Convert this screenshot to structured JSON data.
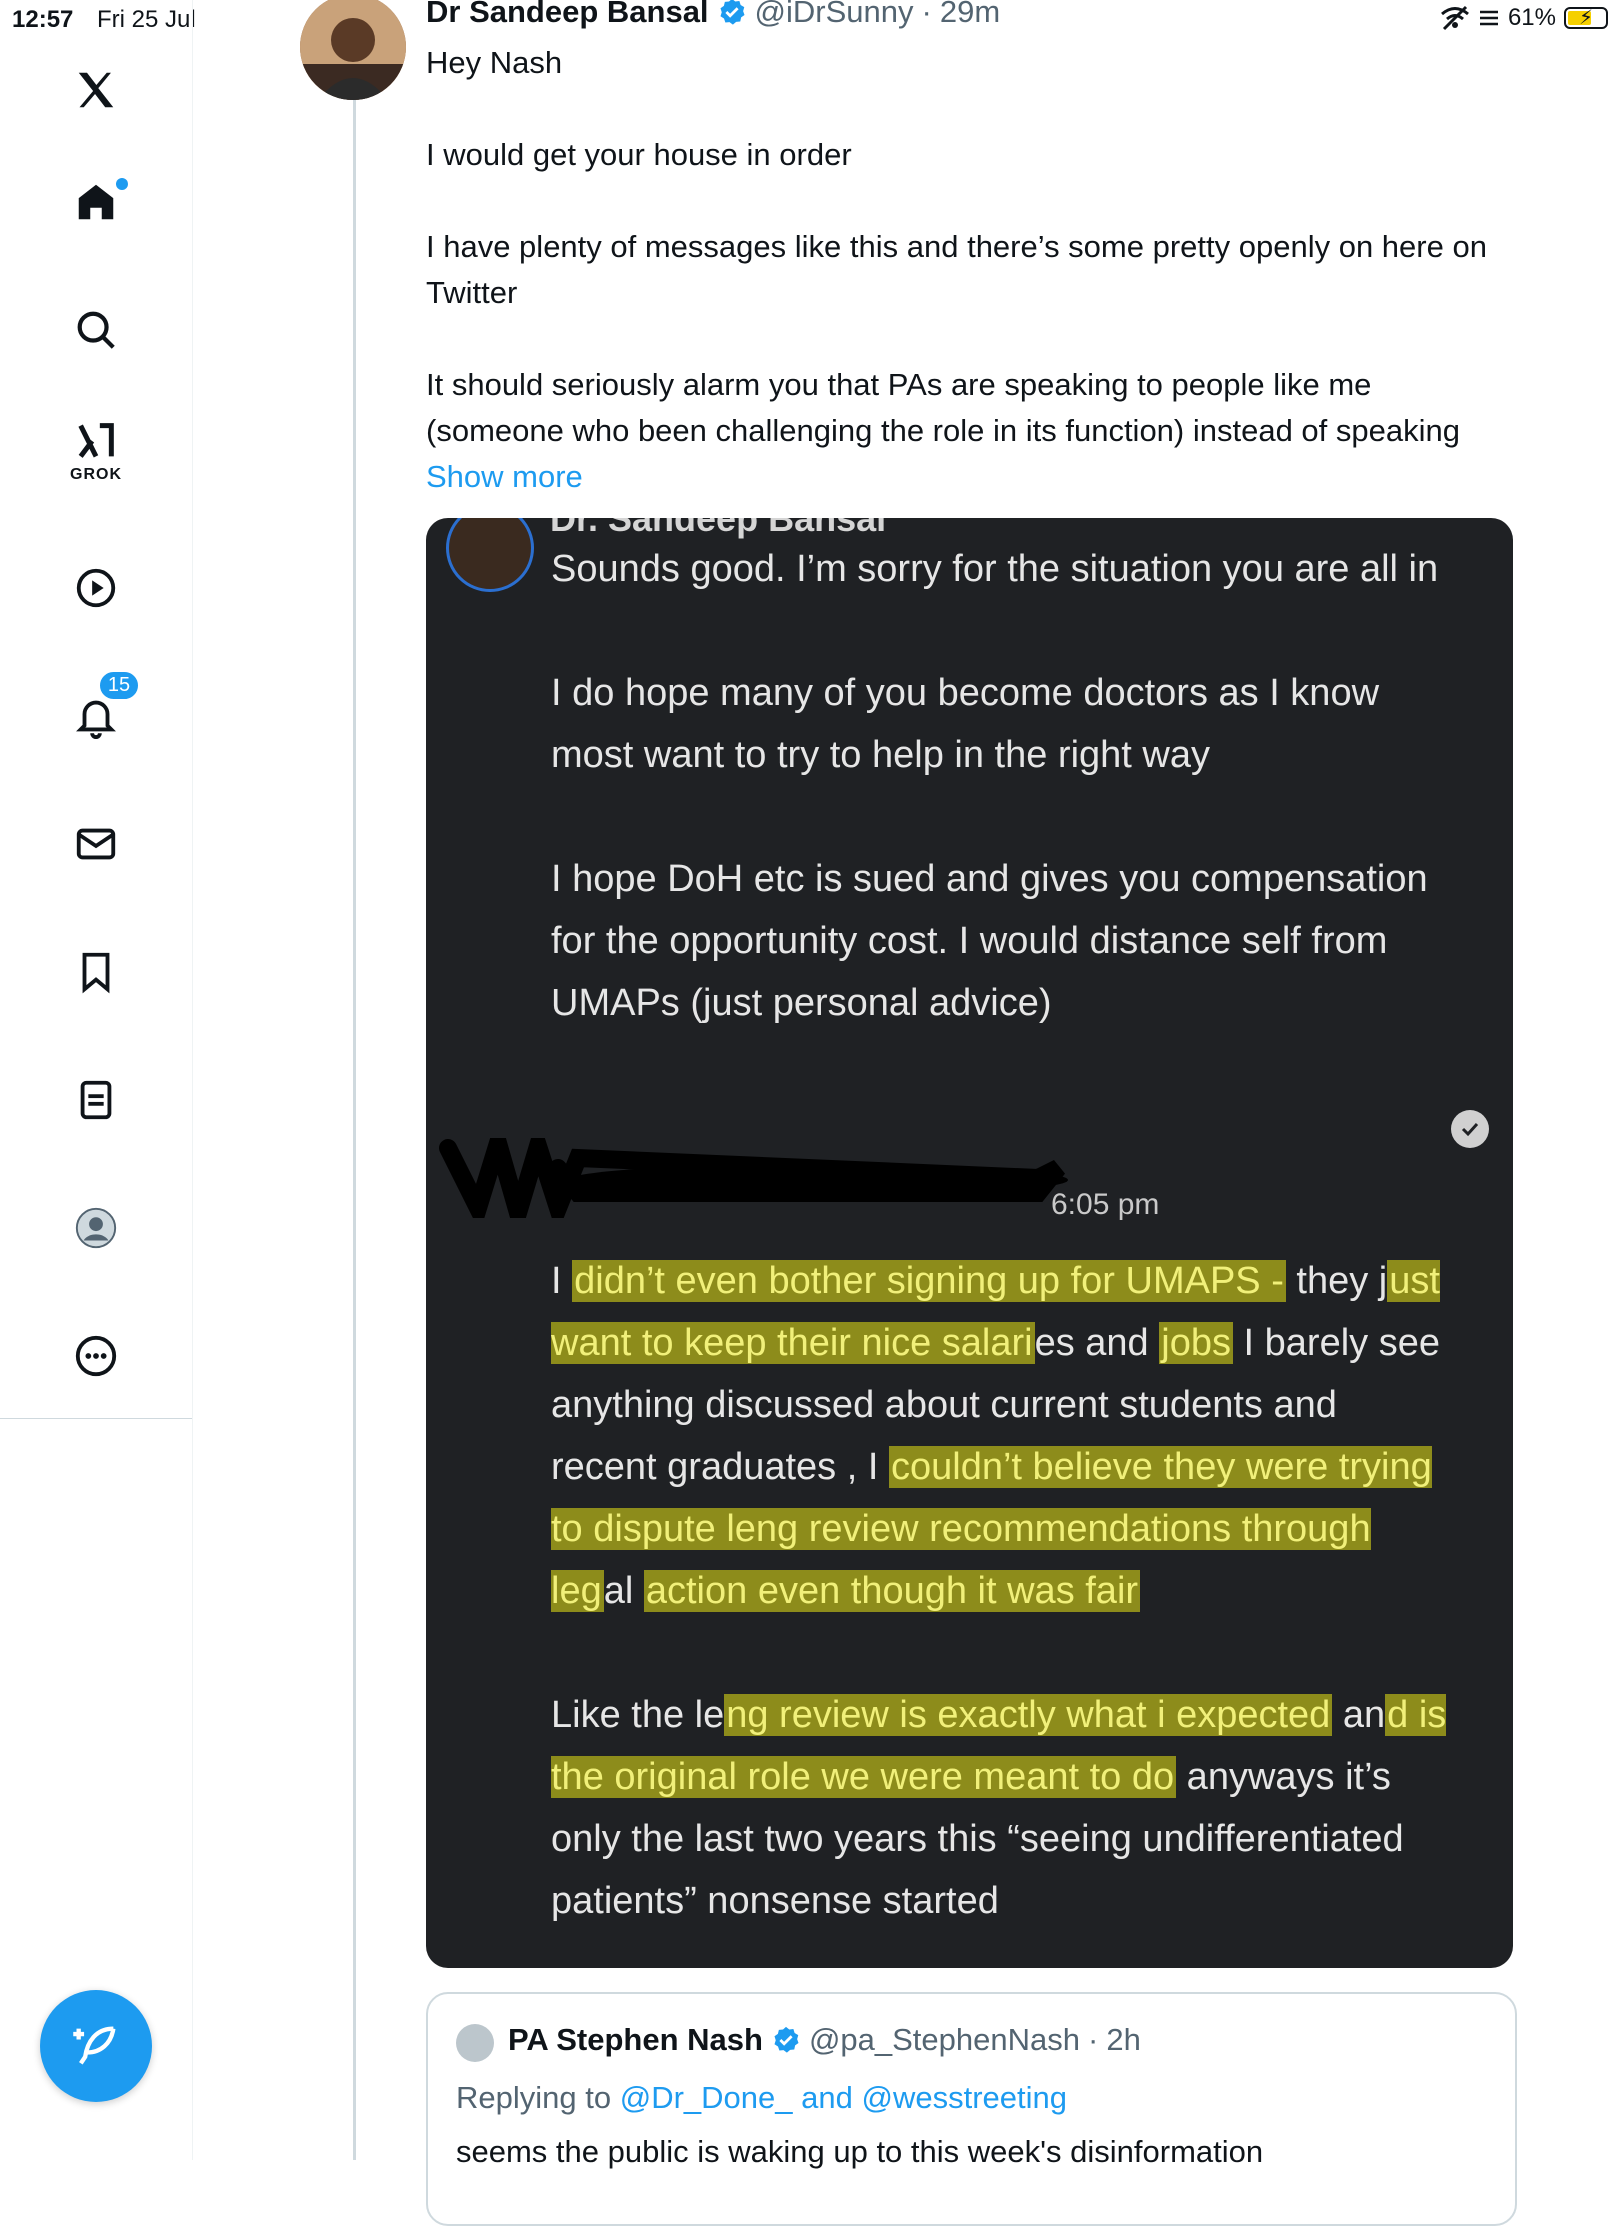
{
  "status_bar": {
    "time": "12:57",
    "date": "Fri 25 Jul",
    "battery": "61%"
  },
  "sidebar": {
    "items": [
      {
        "name": "x-logo",
        "label": ""
      },
      {
        "name": "home",
        "label": ""
      },
      {
        "name": "search",
        "label": ""
      },
      {
        "name": "grok",
        "label": "GROK"
      },
      {
        "name": "video",
        "label": ""
      },
      {
        "name": "notifications",
        "label": "",
        "badge": "15"
      },
      {
        "name": "messages",
        "label": ""
      },
      {
        "name": "bookmarks",
        "label": ""
      },
      {
        "name": "lists",
        "label": ""
      },
      {
        "name": "profile",
        "label": ""
      },
      {
        "name": "more",
        "label": ""
      }
    ],
    "accent": "#1d9bf0"
  },
  "tweet": {
    "author_name": "Dr Sandeep Bansal",
    "author_handle": "@iDrSunny",
    "time": "29m",
    "text": "Hey Nash\n\nI would get your house in order\n\nI have plenty of messages like this and there’s some pretty openly on here on Twitter\n\nIt should seriously alarm you that PAs are speaking to people like me (someone who been challenging the role in its function) instead of speaking",
    "show_more": "Show more"
  },
  "media": {
    "cut_name": "Dr. Sandeep Bansal",
    "message_1": "Sounds good. I’m sorry for the situation you are all in\n\nI do hope many of you become doctors as I know most want to try to help in the right way\n\nI hope DoH etc is sued and gives you compensation for the opportunity cost. I would distance self from UMAPs (just personal advice)",
    "timestamp": "6:05 pm",
    "msg2": {
      "p1": "I ",
      "h1": "didn’t even bother signing up for UMAPS -",
      "p2": " they j",
      "h2": "ust want to keep their nice salari",
      "p3": "es and ",
      "h3": "jobs",
      "p4": " I barely see anything discussed about current students and recent graduates  , I ",
      "h4": "couldn’t believe they were trying to dispute leng review recommendations through leg",
      "p5": "al ",
      "h5": "action even though it was fair",
      "p6": "\n\nLike the le",
      "h6": "ng review is exactly what i expected",
      "p7": " an",
      "h7": "d is the original role we were meant to do",
      "p8": " anyways it’s only the last two years this “seeing undifferentiated patients” nonsense started"
    }
  },
  "quote": {
    "name": "PA Stephen Nash",
    "handle": "@pa_StephenNash",
    "time": "2h",
    "replying_prefix": "Replying to",
    "mention_1": "@Dr_Done_",
    "and_word": "and",
    "mention_2": "@wesstreeting",
    "text": "seems the public is waking up to this week's disinformation"
  }
}
